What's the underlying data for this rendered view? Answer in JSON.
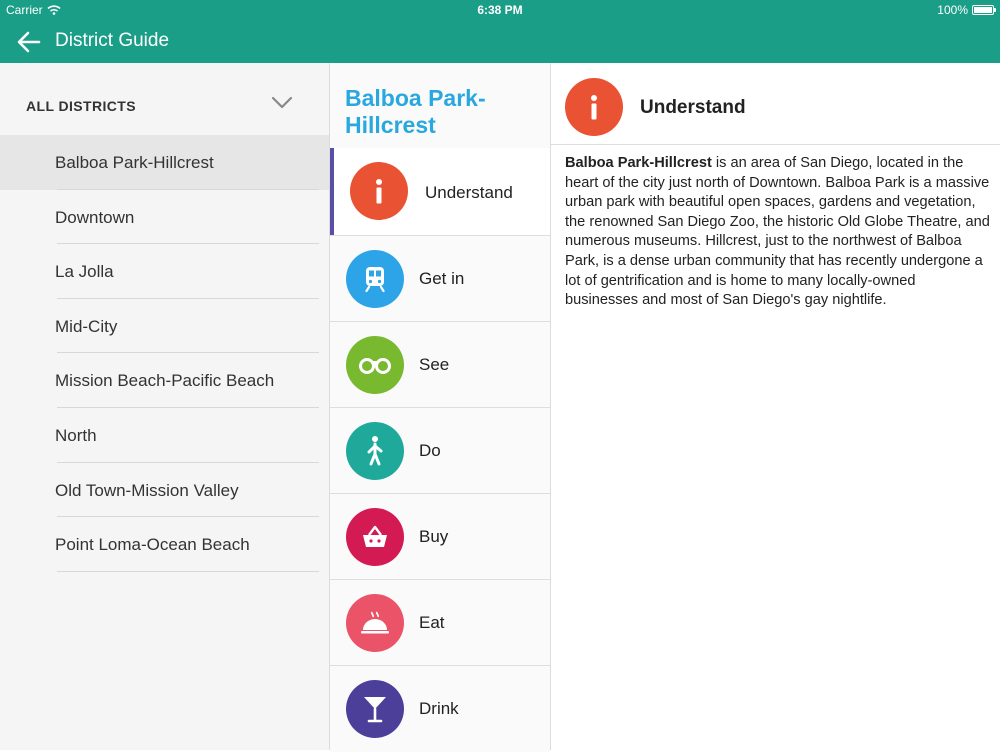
{
  "status_bar": {
    "carrier": "Carrier",
    "time": "6:38 PM",
    "battery": "100%"
  },
  "nav": {
    "title": "District Guide"
  },
  "colors": {
    "nav_bar": "#1a9e87",
    "section_title": "#29a8e0",
    "active_indicator": "#5a4fa8"
  },
  "districts": {
    "header": "ALL DISTRICTS",
    "items": [
      {
        "label": "Balboa Park-Hillcrest",
        "selected": true
      },
      {
        "label": "Downtown"
      },
      {
        "label": "La Jolla"
      },
      {
        "label": "Mid-City"
      },
      {
        "label": "Mission Beach-Pacific Beach"
      },
      {
        "label": "North"
      },
      {
        "label": "Old Town-Mission Valley"
      },
      {
        "label": "Point Loma-Ocean Beach"
      }
    ]
  },
  "guide": {
    "title": "Balboa Park-Hillcrest",
    "sections": [
      {
        "label": "Understand",
        "icon": "info-icon",
        "color": "#ea5234",
        "active": true
      },
      {
        "label": "Get in",
        "icon": "train-icon",
        "color": "#2da4e8"
      },
      {
        "label": "See",
        "icon": "binoculars-icon",
        "color": "#79b92f"
      },
      {
        "label": "Do",
        "icon": "walking-person-icon",
        "color": "#1fa99b"
      },
      {
        "label": "Buy",
        "icon": "basket-icon",
        "color": "#d41a53"
      },
      {
        "label": "Eat",
        "icon": "cloche-icon",
        "color": "#ea5368"
      },
      {
        "label": "Drink",
        "icon": "cocktail-icon",
        "color": "#4b3f9a"
      }
    ]
  },
  "content": {
    "title": "Understand",
    "lead": "Balboa Park-Hillcrest",
    "body": " is an area of San Diego, located in the heart of the city just north of Downtown. Balboa Park is a massive urban park with beautiful open spaces, gardens and vegetation, the renowned San Diego Zoo, the historic Old Globe Theatre, and numerous museums. Hillcrest, just to the northwest of Balboa Park, is a dense urban community that has recently undergone a lot of gentrification and is home to many locally-owned businesses and most of San Diego's gay nightlife."
  }
}
